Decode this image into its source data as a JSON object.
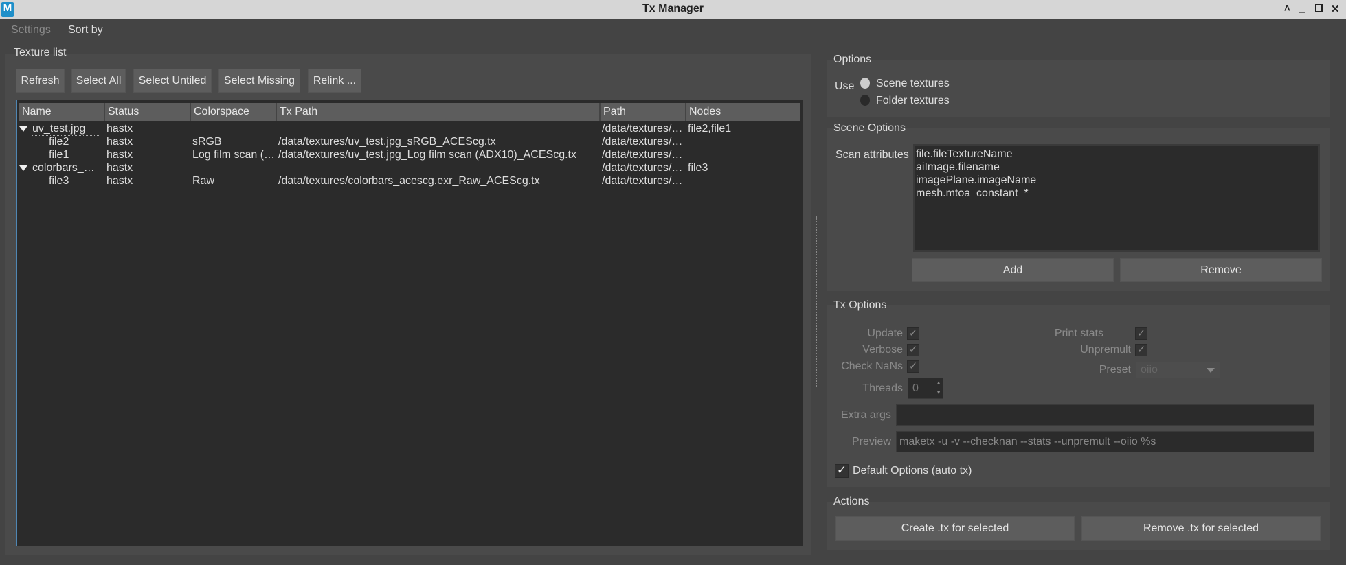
{
  "window": {
    "title": "Tx Manager",
    "app_icon": "M"
  },
  "menu": {
    "settings": "Settings",
    "sort_by": "Sort by"
  },
  "texture_list": {
    "title": "Texture list",
    "buttons": {
      "refresh": "Refresh",
      "select_all": "Select All",
      "select_untiled": "Select Untiled",
      "select_missing": "Select Missing",
      "relink": "Relink ..."
    },
    "columns": [
      "Name",
      "Status",
      "Colorspace",
      "Tx Path",
      "Path",
      "Nodes"
    ],
    "rows": [
      {
        "name": "uv_test.jpg",
        "status": "hastx",
        "colorspace": "",
        "tx_path": "",
        "path": "/data/textures/…",
        "nodes": "file2,file1"
      },
      {
        "name": "file2",
        "status": "hastx",
        "colorspace": "sRGB",
        "tx_path": "/data/textures/uv_test.jpg_sRGB_ACEScg.tx",
        "path": "/data/textures/…",
        "nodes": ""
      },
      {
        "name": "file1",
        "status": "hastx",
        "colorspace": "Log film scan (…",
        "tx_path": "/data/textures/uv_test.jpg_Log film scan (ADX10)_ACEScg.tx",
        "path": "/data/textures/…",
        "nodes": ""
      },
      {
        "name": "colorbars_…",
        "status": "hastx",
        "colorspace": "",
        "tx_path": "",
        "path": "/data/textures/…",
        "nodes": "file3"
      },
      {
        "name": "file3",
        "status": "hastx",
        "colorspace": "Raw",
        "tx_path": "/data/textures/colorbars_acescg.exr_Raw_ACEScg.tx",
        "path": "/data/textures/…",
        "nodes": ""
      }
    ]
  },
  "options": {
    "title": "Options",
    "use_label": "Use",
    "scene_textures": "Scene textures",
    "folder_textures": "Folder textures"
  },
  "scene_options": {
    "title": "Scene Options",
    "scan_label": "Scan attributes",
    "attributes": [
      "file.fileTextureName",
      "aiImage.filename",
      "imagePlane.imageName",
      "mesh.mtoa_constant_*"
    ],
    "add": "Add",
    "remove": "Remove"
  },
  "tx_options": {
    "title": "Tx Options",
    "update": "Update",
    "verbose": "Verbose",
    "check_nans": "Check NaNs",
    "print_stats": "Print stats",
    "unpremult": "Unpremult",
    "preset_label": "Preset",
    "preset_value": "oiio",
    "threads_label": "Threads",
    "threads_value": "0",
    "extra_args_label": "Extra args",
    "extra_args_value": "",
    "preview_label": "Preview",
    "preview_value": "maketx -u -v --checknan --stats --unpremult --oiio %s",
    "default_options": "Default Options (auto tx)",
    "check_mark": "✓"
  },
  "actions": {
    "title": "Actions",
    "create": "Create .tx for selected",
    "remove": "Remove .tx for selected"
  }
}
